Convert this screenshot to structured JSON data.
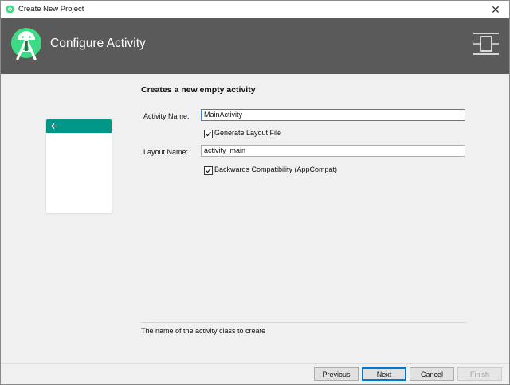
{
  "window": {
    "title": "Create New Project",
    "close_symbol": "✕"
  },
  "banner": {
    "title": "Configure Activity",
    "logo_icon": "android-studio-logo-icon",
    "device_icon": "device-layout-icon",
    "background": "#5a5a5a"
  },
  "preview": {
    "toolbar_color": "#009688",
    "back_icon": "arrow-left-icon"
  },
  "form": {
    "section_title": "Creates a new empty activity",
    "activity_name_label": "Activity Name:",
    "activity_name_value": "MainActivity",
    "generate_layout_label": "Generate Layout File",
    "generate_layout_checked": true,
    "layout_name_label": "Layout Name:",
    "layout_name_value": "activity_main",
    "backwards_compat_label": "Backwards Compatibility (AppCompat)",
    "backwards_compat_checked": true
  },
  "hint": {
    "text": "The name of the activity class to create"
  },
  "footer": {
    "previous_label": "Previous",
    "next_label": "Next",
    "cancel_label": "Cancel",
    "finish_label": "Finish"
  }
}
